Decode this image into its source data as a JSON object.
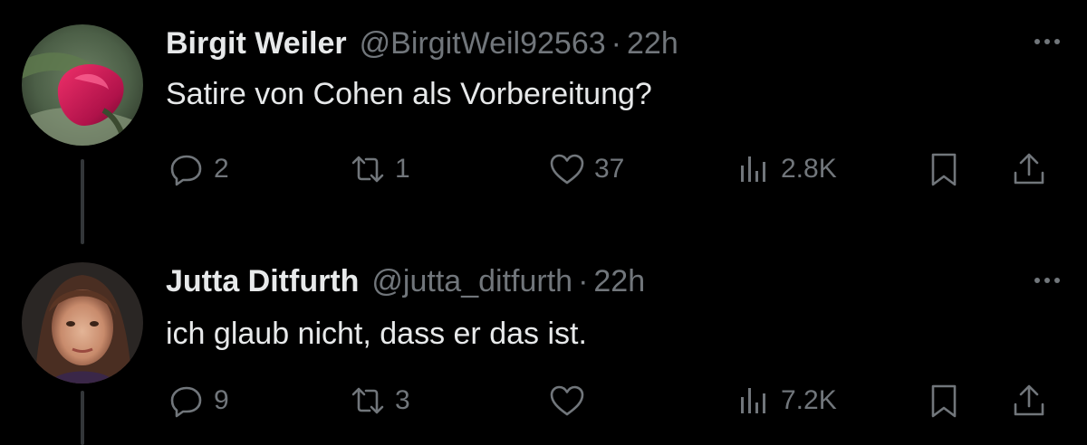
{
  "tweets": [
    {
      "display_name": "Birgit Weiler",
      "handle": "@BirgitWeil92563",
      "separator": "·",
      "time": "22h",
      "text": "Satire von Cohen als Vorbereitung?",
      "avatar_icon": "pink-calla-lily-photo",
      "replies": "2",
      "retweets": "1",
      "likes": "37",
      "views": "2.8K"
    },
    {
      "display_name": "Jutta Ditfurth",
      "handle": "@jutta_ditfurth",
      "separator": "·",
      "time": "22h",
      "text": "ich glaub nicht, dass er das ist.",
      "avatar_icon": "woman-portrait-photo",
      "replies": "9",
      "retweets": "3",
      "likes": "",
      "views": "7.2K"
    }
  ],
  "colors": {
    "background": "#000000",
    "text_primary": "#e7e9ea",
    "text_secondary": "#71767b",
    "thread_line": "#333639"
  }
}
